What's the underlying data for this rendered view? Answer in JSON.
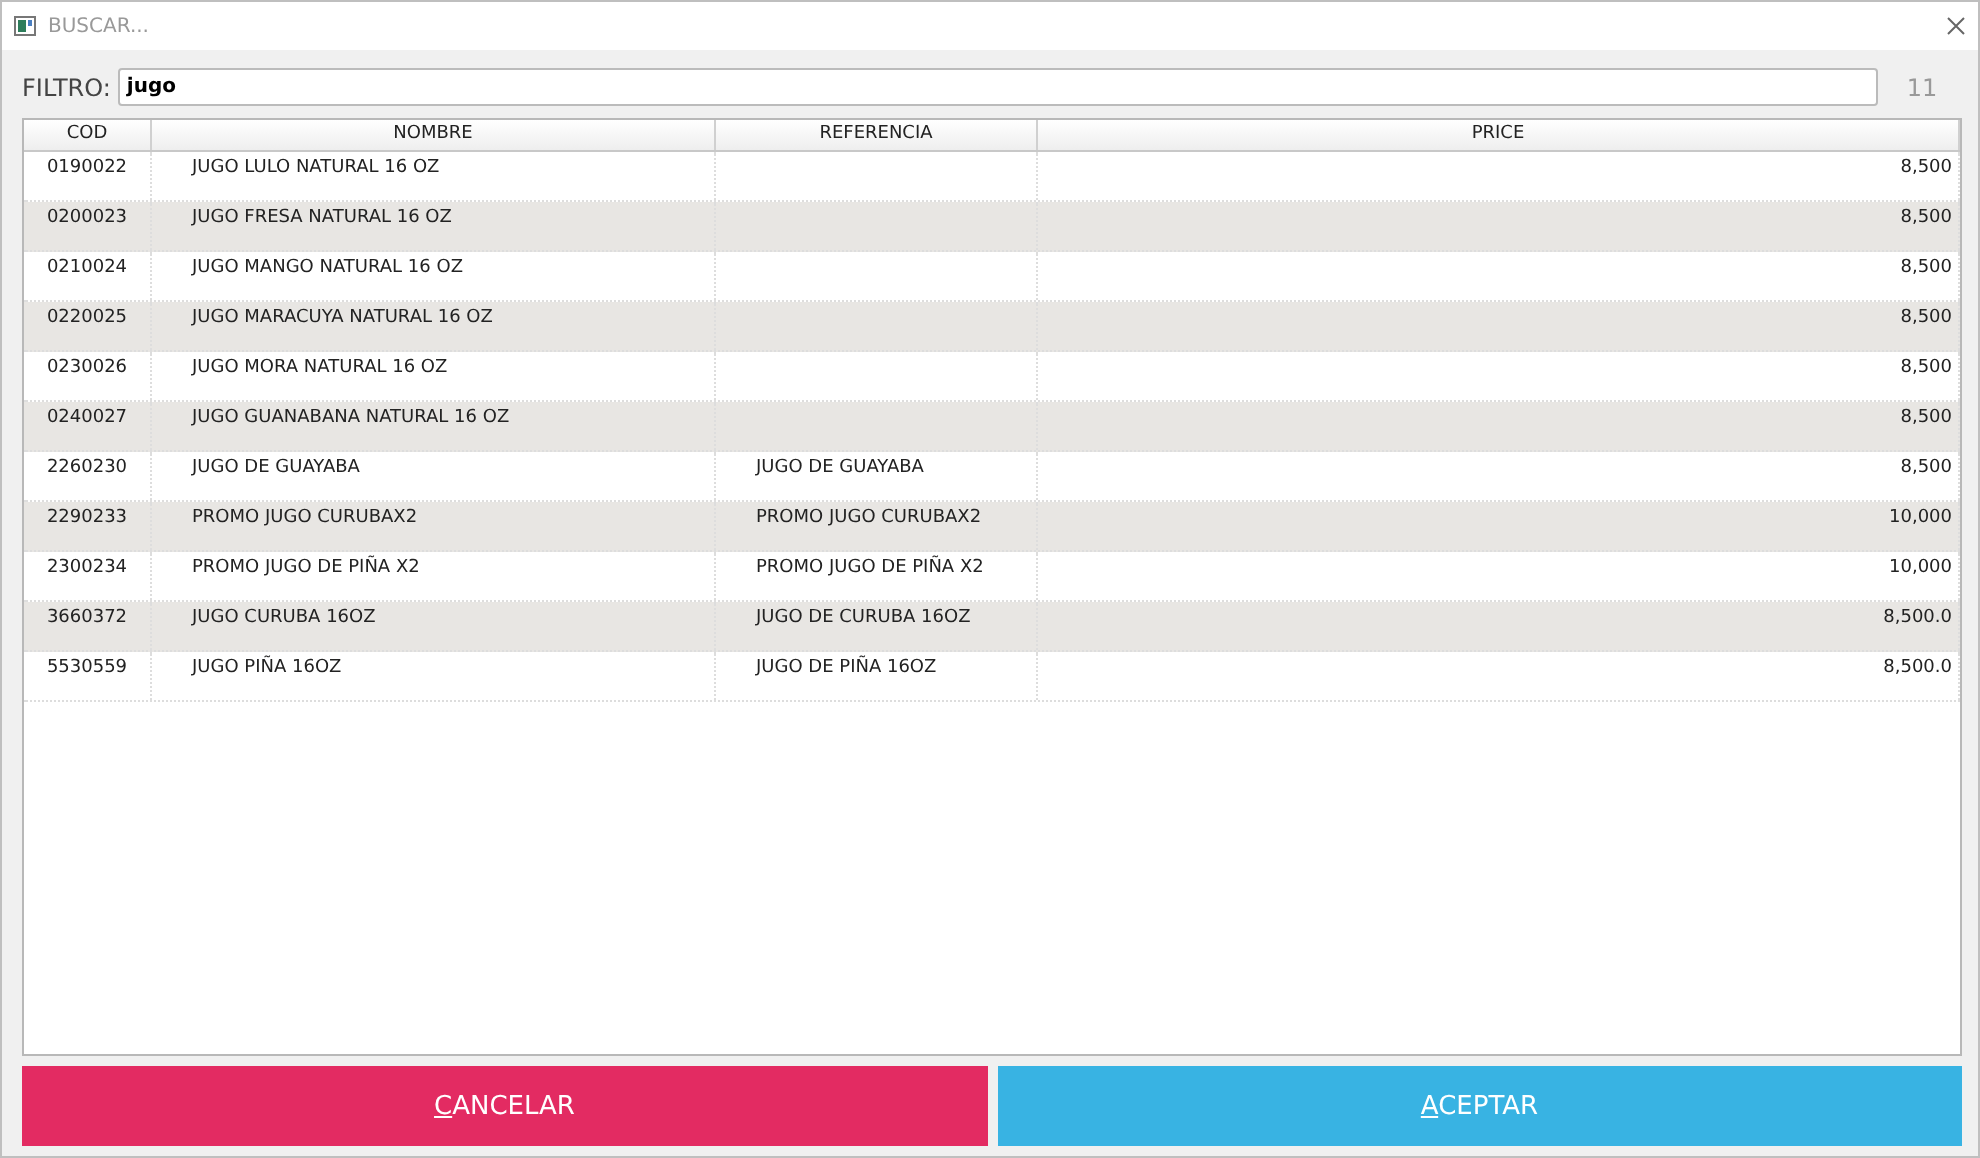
{
  "window": {
    "title": "BUSCAR..."
  },
  "filter": {
    "label": "FILTRO:",
    "value": "jugo",
    "count": "11"
  },
  "table": {
    "columns": [
      "COD",
      "NOMBRE",
      "REFERENCIA",
      "PRICE"
    ],
    "rows": [
      [
        "0190022",
        "JUGO LULO NATURAL 16 OZ",
        "",
        "8,500"
      ],
      [
        "0200023",
        "JUGO FRESA NATURAL 16 OZ",
        "",
        "8,500"
      ],
      [
        "0210024",
        "JUGO MANGO NATURAL 16 OZ",
        "",
        "8,500"
      ],
      [
        "0220025",
        "JUGO MARACUYA NATURAL 16 OZ",
        "",
        "8,500"
      ],
      [
        "0230026",
        "JUGO MORA NATURAL 16 OZ",
        "",
        "8,500"
      ],
      [
        "0240027",
        "JUGO GUANABANA NATURAL 16 OZ",
        "",
        "8,500"
      ],
      [
        "2260230",
        "JUGO DE GUAYABA",
        "JUGO DE GUAYABA",
        "8,500"
      ],
      [
        "2290233",
        "PROMO JUGO CURUBAX2",
        "PROMO JUGO CURUBAX2",
        "10,000"
      ],
      [
        "2300234",
        "PROMO JUGO DE PIÑA X2",
        "PROMO JUGO DE PIÑA X2",
        "10,000"
      ],
      [
        "3660372",
        "JUGO CURUBA 16OZ",
        "JUGO DE CURUBA  16OZ",
        "8,500.0"
      ],
      [
        "5530559",
        "JUGO PIÑA 16OZ",
        "JUGO DE PIÑA 16OZ",
        "8,500.0"
      ]
    ]
  },
  "buttons": [
    {
      "label": "CANCELAR",
      "kind": "cancel",
      "mnemonic_underlined": true
    },
    {
      "label": "ACEPTAR",
      "kind": "accept",
      "mnemonic_underlined": true
    }
  ]
}
